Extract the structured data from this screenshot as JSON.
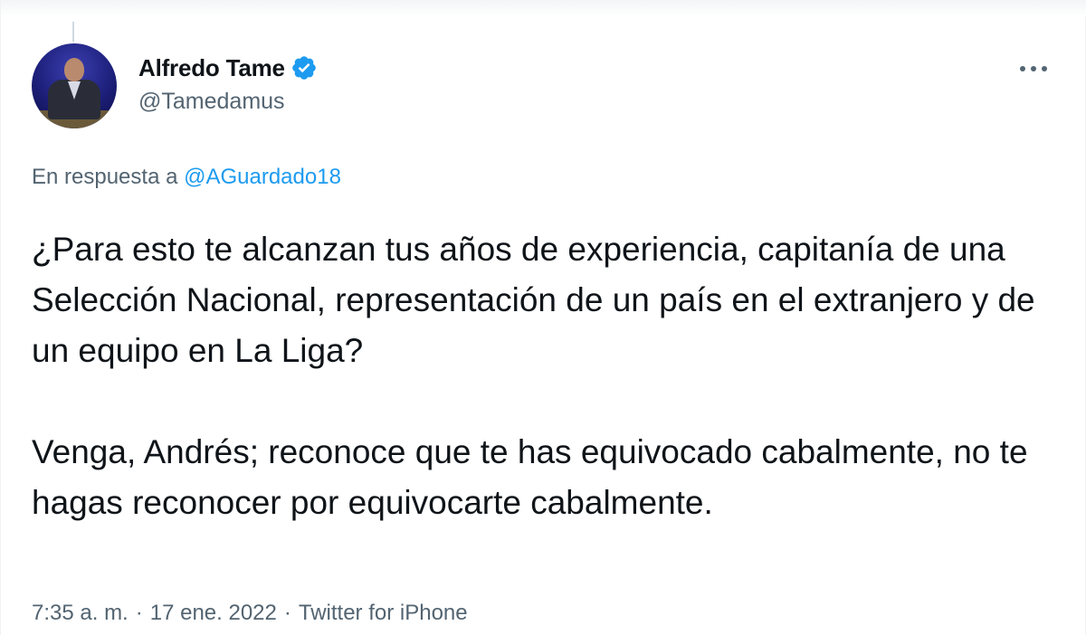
{
  "author": {
    "display_name": "Alfredo Tame",
    "handle": "@Tamedamus",
    "verified": true,
    "verified_icon": "verified-badge-icon"
  },
  "more_icon": "more-horizontal-icon",
  "reply": {
    "prefix": "En respuesta a",
    "mention": "@AGuardado18"
  },
  "tweet": {
    "paragraphs": [
      "¿Para esto te alcanzan tus años de experiencia, capitanía de una Selección Nacional, representación de un país en el extranjero y de un equipo en La Liga?",
      "Venga, Andrés; reconoce que te has equivocado cabalmente, no te hagas reconocer por equivocarte cabalmente."
    ]
  },
  "meta": {
    "time": "7:35 a. m.",
    "date": "17 ene. 2022",
    "source": "Twitter for iPhone",
    "separator": "·"
  },
  "colors": {
    "accent": "#1d9bf0",
    "secondary_text": "#536471",
    "primary_text": "#0f1419"
  }
}
